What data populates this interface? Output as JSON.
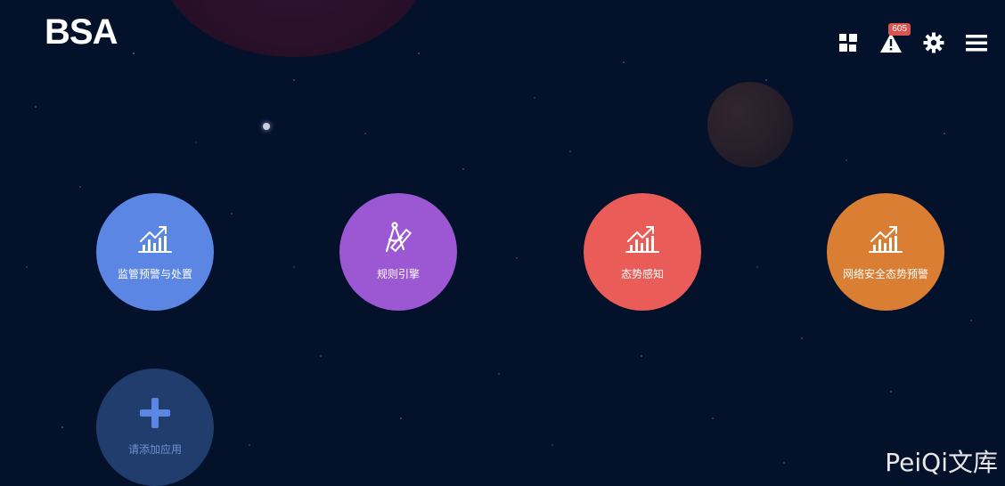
{
  "brand": {
    "logo_text": "BSA"
  },
  "header": {
    "icons": [
      {
        "name": "grid-icon"
      },
      {
        "name": "alert-icon",
        "badge": "605"
      },
      {
        "name": "gear-icon"
      },
      {
        "name": "menu-icon"
      }
    ]
  },
  "apps": [
    {
      "label": "监管预警与处置",
      "icon": "chart-up-icon",
      "color": "#5b86e4"
    },
    {
      "label": "规则引擎",
      "icon": "compass-ruler-icon",
      "color": "#9b58d2"
    },
    {
      "label": "态势感知",
      "icon": "chart-up-icon",
      "color": "#ea5c58"
    },
    {
      "label": "网络安全态势预警",
      "icon": "chart-up-icon",
      "color": "#d97e33"
    }
  ],
  "add_app": {
    "label": "请添加应用",
    "icon": "plus-icon"
  },
  "watermark": "PeiQi文库"
}
